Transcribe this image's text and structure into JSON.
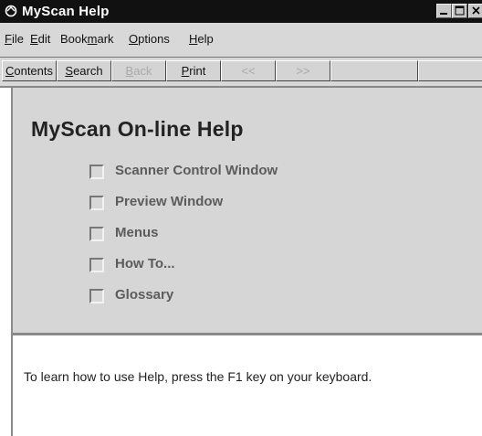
{
  "window": {
    "title": "MyScan Help"
  },
  "menubar": {
    "items": [
      {
        "pre": "",
        "key": "F",
        "post": "ile"
      },
      {
        "pre": "",
        "key": "E",
        "post": "dit"
      },
      {
        "pre": "Book",
        "key": "m",
        "post": "ark"
      },
      {
        "pre": "",
        "key": "O",
        "post": "ptions"
      },
      {
        "pre": "",
        "key": "H",
        "post": "elp"
      }
    ]
  },
  "toolbar": {
    "contents": {
      "key": "C",
      "post": "ontents"
    },
    "search": {
      "key": "S",
      "post": "earch"
    },
    "back": {
      "key": "B",
      "post": "ack"
    },
    "print": {
      "key": "P",
      "post": "rint"
    },
    "prev": "<<",
    "next": ">>"
  },
  "content": {
    "heading": "MyScan On-line Help",
    "topics": [
      "Scanner Control Window",
      "Preview Window",
      "Menus",
      "How To...",
      "Glossary"
    ]
  },
  "footer": {
    "note": "To learn how to use Help, press the F1 key on your keyboard."
  },
  "colors": {
    "titlebar": "#111111",
    "window": "#d8d8d8"
  },
  "icons": [
    "app-icon",
    "minimize-icon",
    "maximize-icon",
    "close-icon"
  ]
}
